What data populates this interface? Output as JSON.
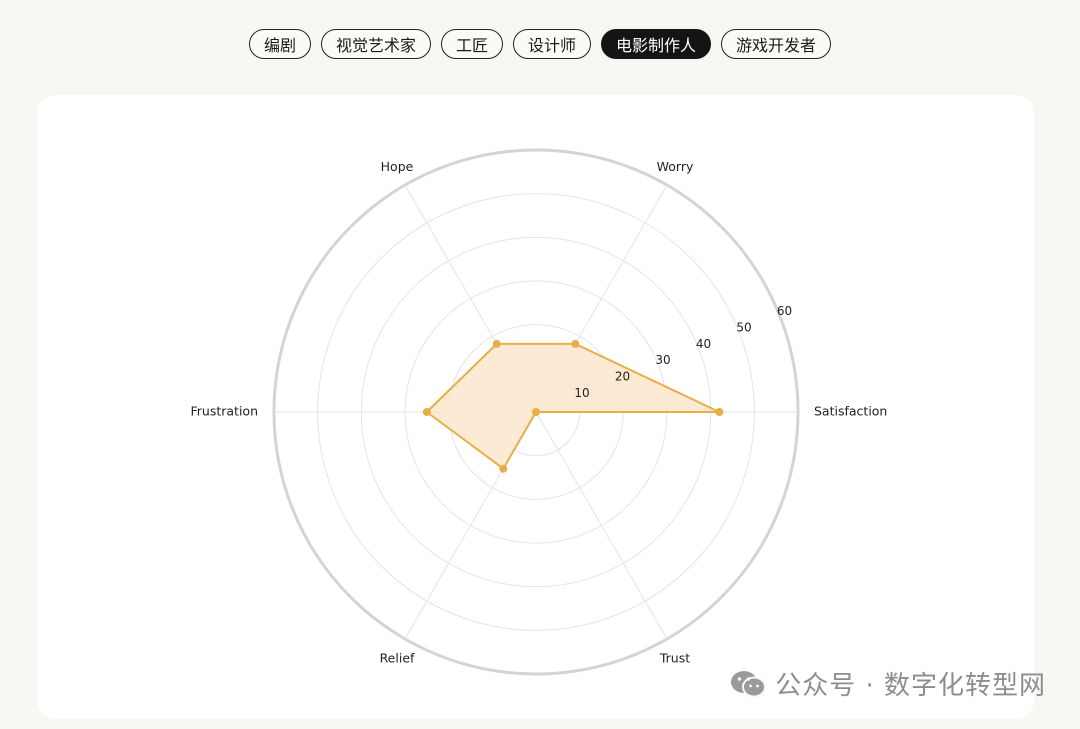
{
  "tabs": [
    {
      "label": "编剧",
      "active": false
    },
    {
      "label": "视觉艺术家",
      "active": false
    },
    {
      "label": "工匠",
      "active": false
    },
    {
      "label": "设计师",
      "active": false
    },
    {
      "label": "电影制作人",
      "active": true
    },
    {
      "label": "游戏开发者",
      "active": false
    }
  ],
  "chart_data": {
    "type": "radar",
    "categories": [
      "Satisfaction",
      "Worry",
      "Hope",
      "Frustration",
      "Relief",
      "Trust"
    ],
    "series": [
      {
        "values": [
          42,
          18,
          18,
          25,
          15,
          0
        ],
        "color": "#e8ae48",
        "fill": "#fbe6cc"
      }
    ],
    "rlim": [
      0,
      60
    ],
    "rticks": [
      10,
      20,
      30,
      40,
      50,
      60
    ],
    "grid": true
  },
  "watermark": {
    "text": "公众号 · 数字化转型网",
    "icon": "wechat-icon"
  }
}
